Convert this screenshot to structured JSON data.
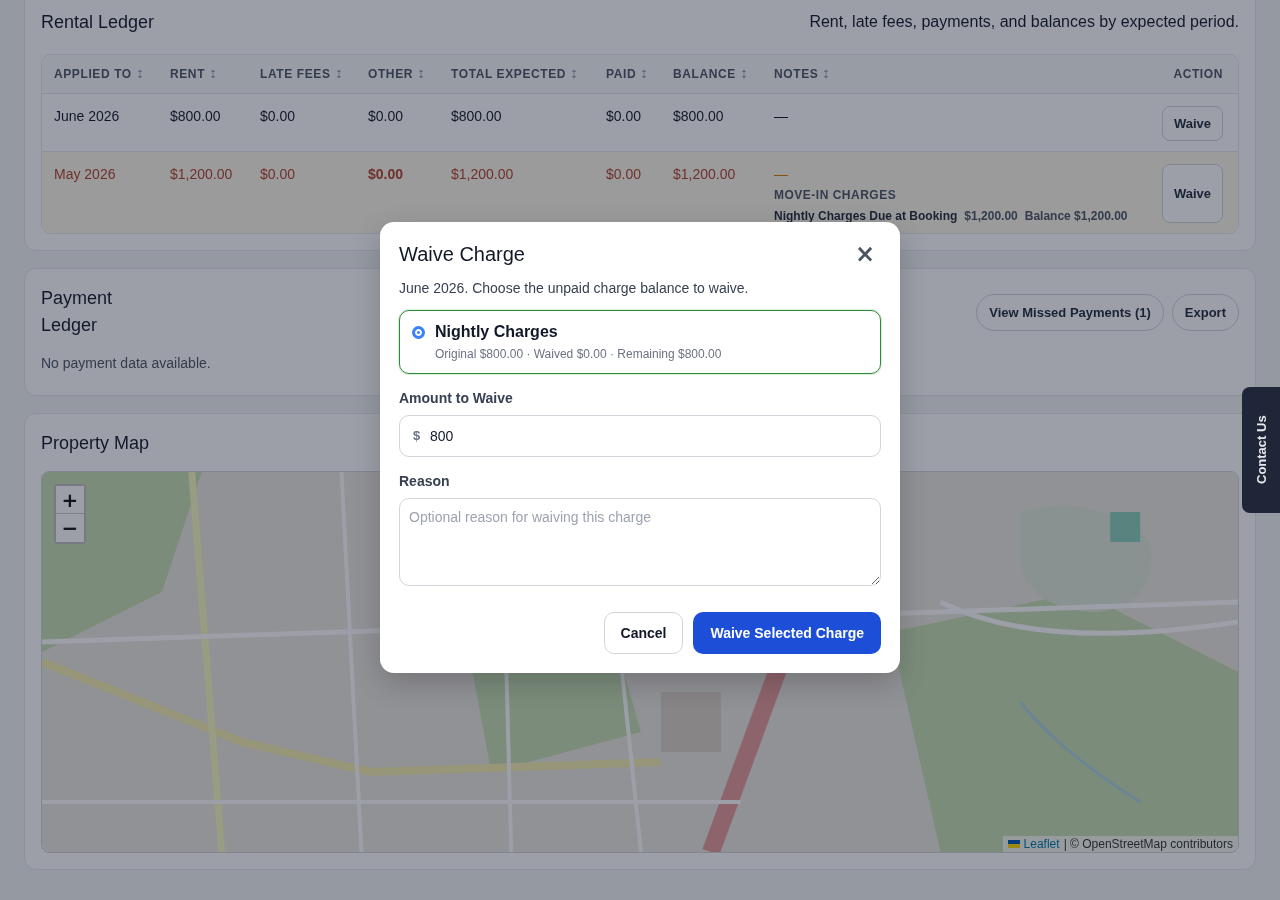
{
  "rental_ledger": {
    "title": "Rental Ledger",
    "subtitle": "Rent, late fees, payments, and balances by expected period.",
    "columns": [
      {
        "label": "APPLIED TO",
        "sortable": true
      },
      {
        "label": "RENT",
        "sortable": true
      },
      {
        "label": "LATE FEES",
        "sortable": true
      },
      {
        "label": "OTHER",
        "sortable": true
      },
      {
        "label": "TOTAL EXPECTED",
        "sortable": true
      },
      {
        "label": "PAID",
        "sortable": true
      },
      {
        "label": "BALANCE",
        "sortable": true
      },
      {
        "label": "NOTES",
        "sortable": true
      },
      {
        "label": "ACTION",
        "sortable": false
      }
    ],
    "rows": [
      {
        "overdue": false,
        "cells": [
          {
            "text": "June 2026",
            "bold": false
          },
          {
            "text": "$800.00",
            "bold": false
          },
          {
            "text": "$0.00",
            "bold": false
          },
          {
            "text": "$0.00",
            "bold": false
          },
          {
            "text": "$800.00",
            "bold": false
          },
          {
            "text": "$0.00",
            "bold": false
          },
          {
            "text": "$800.00",
            "bold": false
          }
        ],
        "note": "—",
        "action": "Waive"
      },
      {
        "overdue": true,
        "cells": [
          {
            "text": "May 2026",
            "bold": false
          },
          {
            "text": "$1,200.00",
            "bold": false
          },
          {
            "text": "$0.00",
            "bold": false
          },
          {
            "text": "$0.00",
            "bold": true
          },
          {
            "text": "$1,200.00",
            "bold": false
          },
          {
            "text": "$0.00",
            "bold": false
          },
          {
            "text": "$1,200.00",
            "bold": false
          }
        ],
        "note": "—",
        "note_section": {
          "title": "MOVE-IN CHARGES",
          "name": "Nightly Charges Due at Booking",
          "amount": "$1,200.00",
          "balance": "Balance $1,200.00"
        },
        "action": "Waive"
      }
    ]
  },
  "payment_ledger": {
    "title": "Payment Ledger",
    "buttons": [
      "View Missed Payments (1)",
      "Export"
    ],
    "empty_text": "No payment data available."
  },
  "property_map": {
    "title": "Property Map",
    "zoom_in": "+",
    "zoom_out": "−",
    "attribution_link": "Leaflet",
    "attribution_text": "| © OpenStreetMap contributors"
  },
  "contact_tab": "Contact Us",
  "dialog": {
    "title": "Waive Charge",
    "close": "×",
    "description": "June 2026. Choose the unpaid charge balance to waive.",
    "options": [
      {
        "label": "Nightly Charges",
        "detail": "Original $800.00 · Waived $0.00 · Remaining $800.00",
        "selected": true
      }
    ],
    "amount_label": "Amount to Waive",
    "currency": "$",
    "amount_value": "800",
    "reason_label": "Reason",
    "reason_placeholder": "Optional reason for waiving this charge",
    "cancel": "Cancel",
    "confirm": "Waive Selected Charge"
  }
}
